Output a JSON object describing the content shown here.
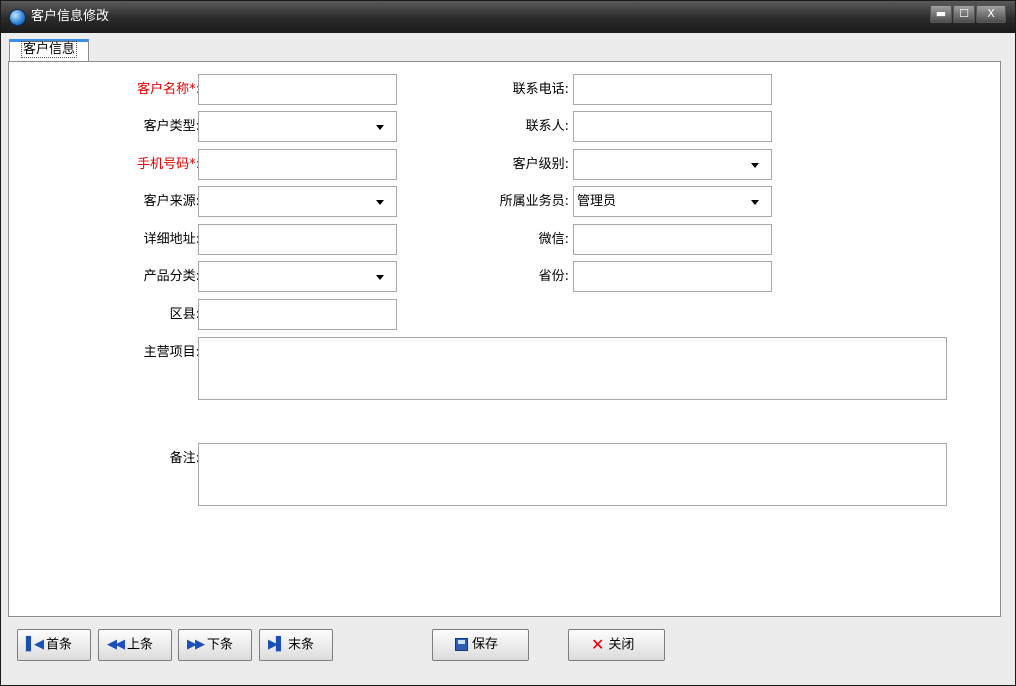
{
  "window": {
    "title": "客户信息修改",
    "icon": "app-globe-icon",
    "controls": {
      "minimize": "▬",
      "maximize": "☐",
      "close": "X"
    }
  },
  "tabs": [
    {
      "label": "客户信息",
      "active": true
    }
  ],
  "form": {
    "left": [
      {
        "label": "客户名称*:",
        "required": true,
        "type": "text",
        "value": ""
      },
      {
        "label": "客户类型:",
        "required": false,
        "type": "select",
        "value": ""
      },
      {
        "label": "手机号码*:",
        "required": true,
        "type": "text",
        "value": ""
      },
      {
        "label": "客户来源:",
        "required": false,
        "type": "select",
        "value": ""
      },
      {
        "label": "详细地址:",
        "required": false,
        "type": "text",
        "value": ""
      },
      {
        "label": "产品分类:",
        "required": false,
        "type": "select",
        "value": ""
      },
      {
        "label": "区县:",
        "required": false,
        "type": "text",
        "value": ""
      }
    ],
    "right": [
      {
        "label": "联系电话:",
        "type": "text",
        "value": ""
      },
      {
        "label": "联系人:",
        "type": "text",
        "value": ""
      },
      {
        "label": "客户级别:",
        "type": "select",
        "value": ""
      },
      {
        "label": "所属业务员:",
        "type": "select",
        "value": "管理员"
      },
      {
        "label": "微信:",
        "type": "text",
        "value": ""
      },
      {
        "label": "省份:",
        "type": "text",
        "value": ""
      }
    ],
    "main_business": {
      "label": "主营项目:",
      "value": ""
    },
    "remarks": {
      "label": "备注:",
      "value": ""
    }
  },
  "buttons": {
    "first": {
      "label": "首条",
      "icon": "first-record-icon"
    },
    "prev": {
      "label": "上条",
      "icon": "previous-record-icon"
    },
    "next": {
      "label": "下条",
      "icon": "next-record-icon"
    },
    "last": {
      "label": "末条",
      "icon": "last-record-icon"
    },
    "save": {
      "label": "保存",
      "icon": "save-disk-icon"
    },
    "close": {
      "label": "关闭",
      "icon": "close-x-icon"
    }
  },
  "colors": {
    "required_label": "#e00000",
    "nav_icon": "#1b4fb8",
    "tab_accent": "#3a8ee6"
  }
}
